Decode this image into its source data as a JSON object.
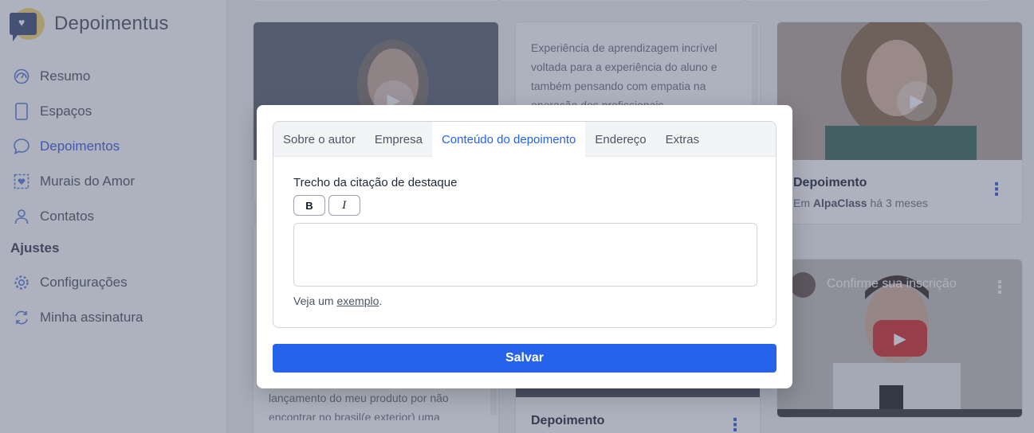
{
  "app": {
    "name": "Depoimentus"
  },
  "sidebar": {
    "items": [
      {
        "label": "Resumo",
        "icon": "dashboard-icon"
      },
      {
        "label": "Espaços",
        "icon": "tablet-icon"
      },
      {
        "label": "Depoimentos",
        "icon": "chat-bubble-icon",
        "active": true
      },
      {
        "label": "Murais do Amor",
        "icon": "heart-frame-icon"
      },
      {
        "label": "Contatos",
        "icon": "user-icon"
      }
    ],
    "settings_heading": "Ajustes",
    "settings_items": [
      {
        "label": "Configurações",
        "icon": "gear-icon"
      },
      {
        "label": "Minha assinatura",
        "icon": "refresh-icon"
      }
    ]
  },
  "cards": {
    "quote_top": "Experiência de aprendizagem incrível voltada para a experiência do aluno e também pensando com empatia na operação dos profissionais",
    "right_top": {
      "title": "Depoimento",
      "prefix": "Em",
      "company": "AlpaClass",
      "time": "há 3 meses"
    },
    "youtube_title": "Confirme sua inscrição",
    "bottom_left_text": "lançamento do meu produto por não encontrar no brasil(e exterior) uma",
    "bottom_middle_title": "Depoimento"
  },
  "modal": {
    "tabs": [
      {
        "label": "Sobre o autor"
      },
      {
        "label": "Empresa"
      },
      {
        "label": "Conteúdo do depoimento",
        "active": true
      },
      {
        "label": "Endereço"
      },
      {
        "label": "Extras"
      }
    ],
    "field_label": "Trecho da citação de destaque",
    "bold_label": "B",
    "italic_label": "I",
    "textarea_value": "",
    "example_prefix": "Veja um",
    "example_link": "exemplo",
    "example_suffix": ".",
    "save_label": "Salvar"
  },
  "colors": {
    "accent": "#2563eb",
    "nav_active": "#3b5bdb",
    "overlay": "#4b556e"
  }
}
